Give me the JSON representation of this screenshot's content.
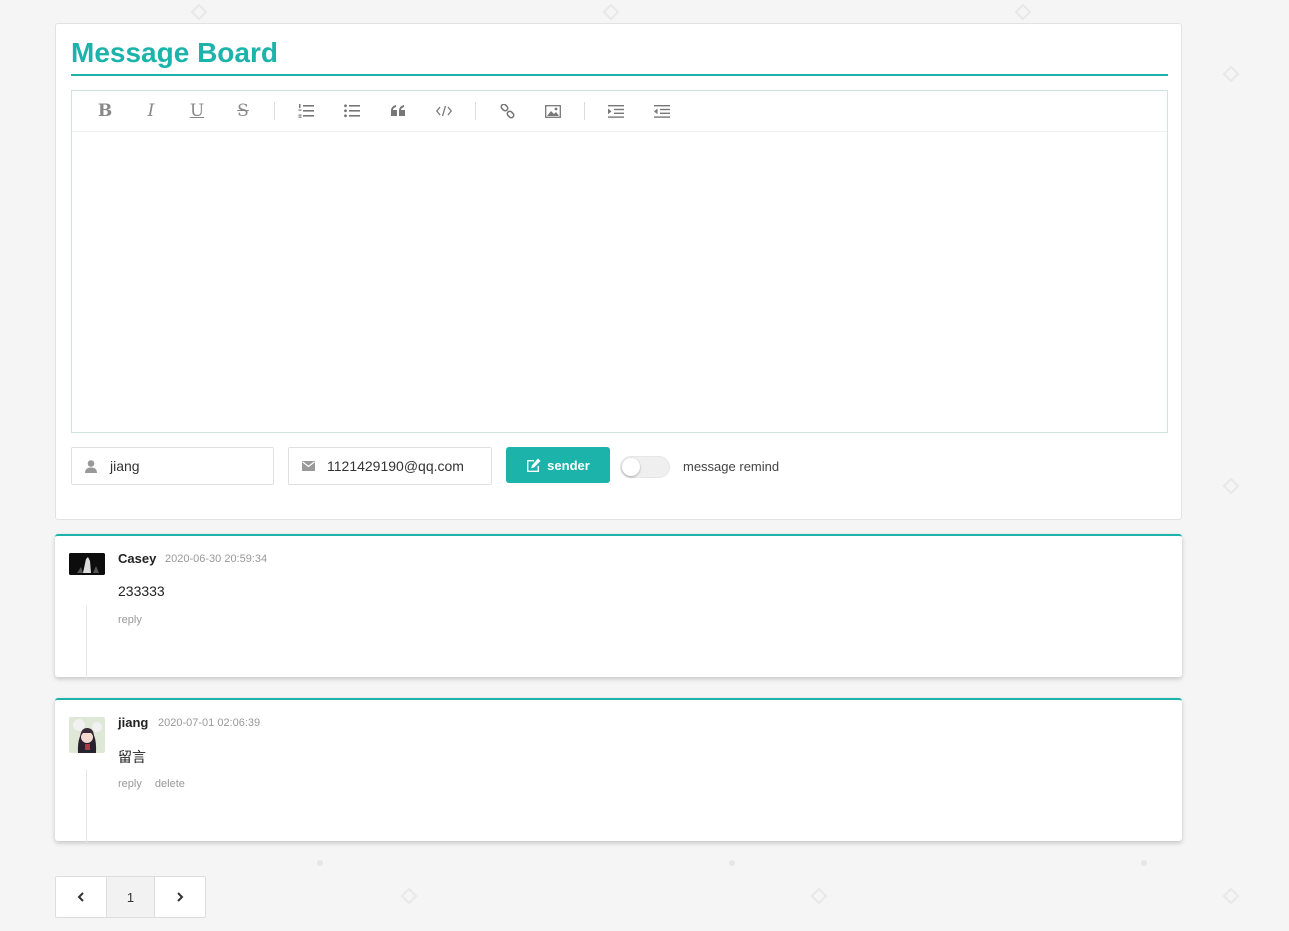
{
  "board": {
    "title": "Message Board"
  },
  "toolbar": {
    "buttons": [
      "bold-icon",
      "italic-icon",
      "underline-icon",
      "strikethrough-icon",
      "ordered-list-icon",
      "unordered-list-icon",
      "quote-icon",
      "code-icon",
      "link-icon",
      "image-icon",
      "indent-icon",
      "outdent-icon"
    ]
  },
  "form": {
    "name_value": "jiang",
    "email_value": "1121429190@qq.com",
    "send_label": "sender",
    "remind_label": "message remind",
    "remind_on": false
  },
  "comments": [
    {
      "author": "Casey",
      "time": "2020-06-30 20:59:34",
      "text": "233333",
      "reply_label": "reply"
    },
    {
      "author": "jiang",
      "time": "2020-07-01 02:06:39",
      "text": "留言",
      "reply_label": "reply",
      "delete_label": "delete"
    }
  ],
  "pager": {
    "prev_icon": "chevron-left-icon",
    "current": "1",
    "next_icon": "chevron-right-icon"
  },
  "colors": {
    "accent": "#1bb3aa"
  }
}
